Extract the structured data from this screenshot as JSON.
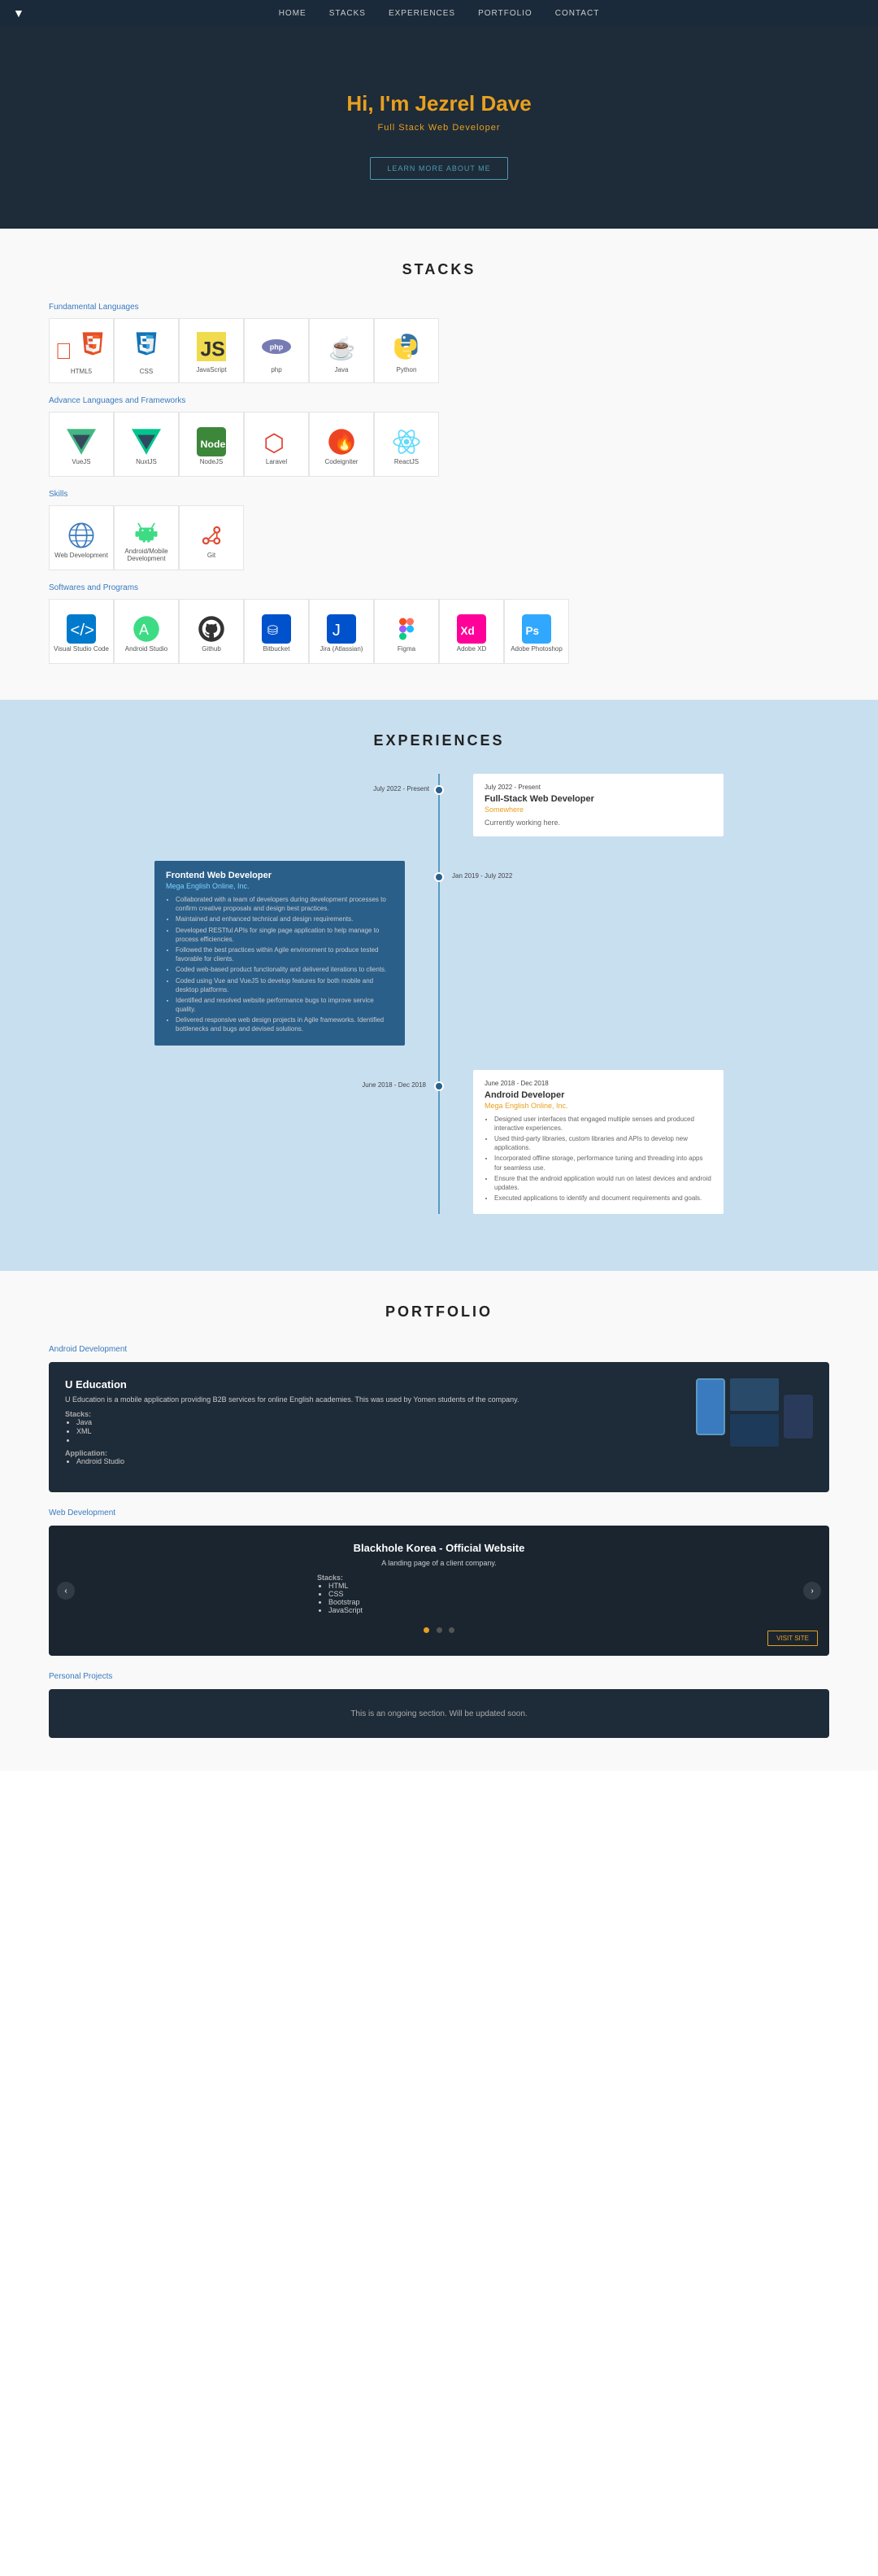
{
  "nav": {
    "logo": "V",
    "links": [
      "HOME",
      "STACKS",
      "EXPERIENCES",
      "PORTFOLIO",
      "CONTACT"
    ]
  },
  "hero": {
    "greeting": "Hi, I'm ",
    "name": "Jezrel Dave",
    "subtitle": "Full Stack Web Developer",
    "cta": "LEARN MORE ABOUT ME"
  },
  "stacks": {
    "title": "STACKS",
    "categories": [
      {
        "label": "Fundamental Languages",
        "items": [
          {
            "name": "HTML5",
            "icon": "html5"
          },
          {
            "name": "CSS",
            "icon": "css3"
          },
          {
            "name": "JavaScript",
            "icon": "js"
          },
          {
            "name": "php",
            "icon": "php"
          },
          {
            "name": "Java",
            "icon": "java"
          },
          {
            "name": "Python",
            "icon": "python"
          }
        ]
      },
      {
        "label": "Advance Languages and Frameworks",
        "items": [
          {
            "name": "VueJS",
            "icon": "vuejs"
          },
          {
            "name": "NuxtJS",
            "icon": "nuxtjs"
          },
          {
            "name": "NodeJS",
            "icon": "nodejs"
          },
          {
            "name": "Laravel",
            "icon": "laravel"
          },
          {
            "name": "Codeigniter",
            "icon": "codeigniter"
          },
          {
            "name": "ReactJS",
            "icon": "react"
          }
        ]
      },
      {
        "label": "Skills",
        "items": [
          {
            "name": "Web Development",
            "icon": "globe"
          },
          {
            "name": "Android/Mobile Development",
            "icon": "android"
          },
          {
            "name": "Git",
            "icon": "git"
          }
        ]
      },
      {
        "label": "Softwares and Programs",
        "items": [
          {
            "name": "Visual Studio Code",
            "icon": "vscode"
          },
          {
            "name": "Android Studio",
            "icon": "android2"
          },
          {
            "name": "Github",
            "icon": "github"
          },
          {
            "name": "Bitbucket",
            "icon": "bitbucket"
          },
          {
            "name": "Jira (Atlassian)",
            "icon": "jira"
          },
          {
            "name": "Figma",
            "icon": "figma"
          },
          {
            "name": "Adobe XD",
            "icon": "adobexd"
          },
          {
            "name": "Adobe Photoshop",
            "icon": "adobeps"
          }
        ]
      }
    ]
  },
  "experiences": {
    "title": "EXPERIENCES",
    "items": [
      {
        "title": "Full-Stack Web Developer",
        "company": "Somewhere",
        "date": "July 2022 - Present",
        "side": "right",
        "bullets": [
          "Currently working here."
        ]
      },
      {
        "title": "Frontend Web Developer",
        "company": "Mega English Online, Inc.",
        "date": "Jan 2019 - July 2022",
        "side": "left",
        "bullets": [
          "Collaborated with a team of developers during development processes to confirm creative proposals and design best practices.",
          "Maintained and enhanced technical and design requirements.",
          "Developed RESTful APIs for single page application to help manage to process efficiencies.",
          "Followed the best practices within Agile environment to produce tested favorable for clients.",
          "Coded web-based product functionality and delivered iterations to clients.",
          "Coded using Vue and VueJS to develop features for both mobile and desktop platforms.",
          "Identified and resolved website performance bugs to improve service quality.",
          "Delivered responsive web design projects in Agile frameworks. Identified bottlenecks and bugs and devised solutions."
        ]
      },
      {
        "title": "Android Developer",
        "company": "Mega English Online, Inc.",
        "date": "June 2018 - Dec 2018",
        "side": "right",
        "bullets": [
          "Designed user interfaces that engaged multiple senses and produced interactive experiences.",
          "Used third-party libraries, custom libraries and APIs to develop new applications.",
          "Incorporated offline storage, performance tuning and threading into apps for seamless use.",
          "Ensure that the android application would run on latest devices and android updates.",
          "Executed applications to identify and document requirements and goals."
        ]
      }
    ]
  },
  "portfolio": {
    "title": "PORTFOLIO",
    "categories": [
      {
        "label": "Android Development",
        "projects": [
          {
            "name": "U Education",
            "description": "U Education is a mobile application providing B2B services for online English academies. This was used by Yomen students of the company.",
            "stacks": {
              "label": "Stacks:",
              "items": [
                "Java",
                "XML"
              ]
            },
            "application": {
              "label": "Application:",
              "items": [
                "Android Studio"
              ]
            }
          }
        ]
      },
      {
        "label": "Web Development",
        "projects": [
          {
            "name": "Blackhole Korea - Official Website",
            "description": "A landing page of a client company.",
            "stacks": {
              "label": "Stacks:",
              "items": [
                "HTML",
                "CSS",
                "Bootstrap",
                "JavaScript"
              ]
            },
            "visitSite": "VISIT SITE"
          }
        ]
      },
      {
        "label": "Personal Projects",
        "projects": [
          {
            "description": "This is an ongoing section. Will be updated soon."
          }
        ]
      }
    ]
  }
}
